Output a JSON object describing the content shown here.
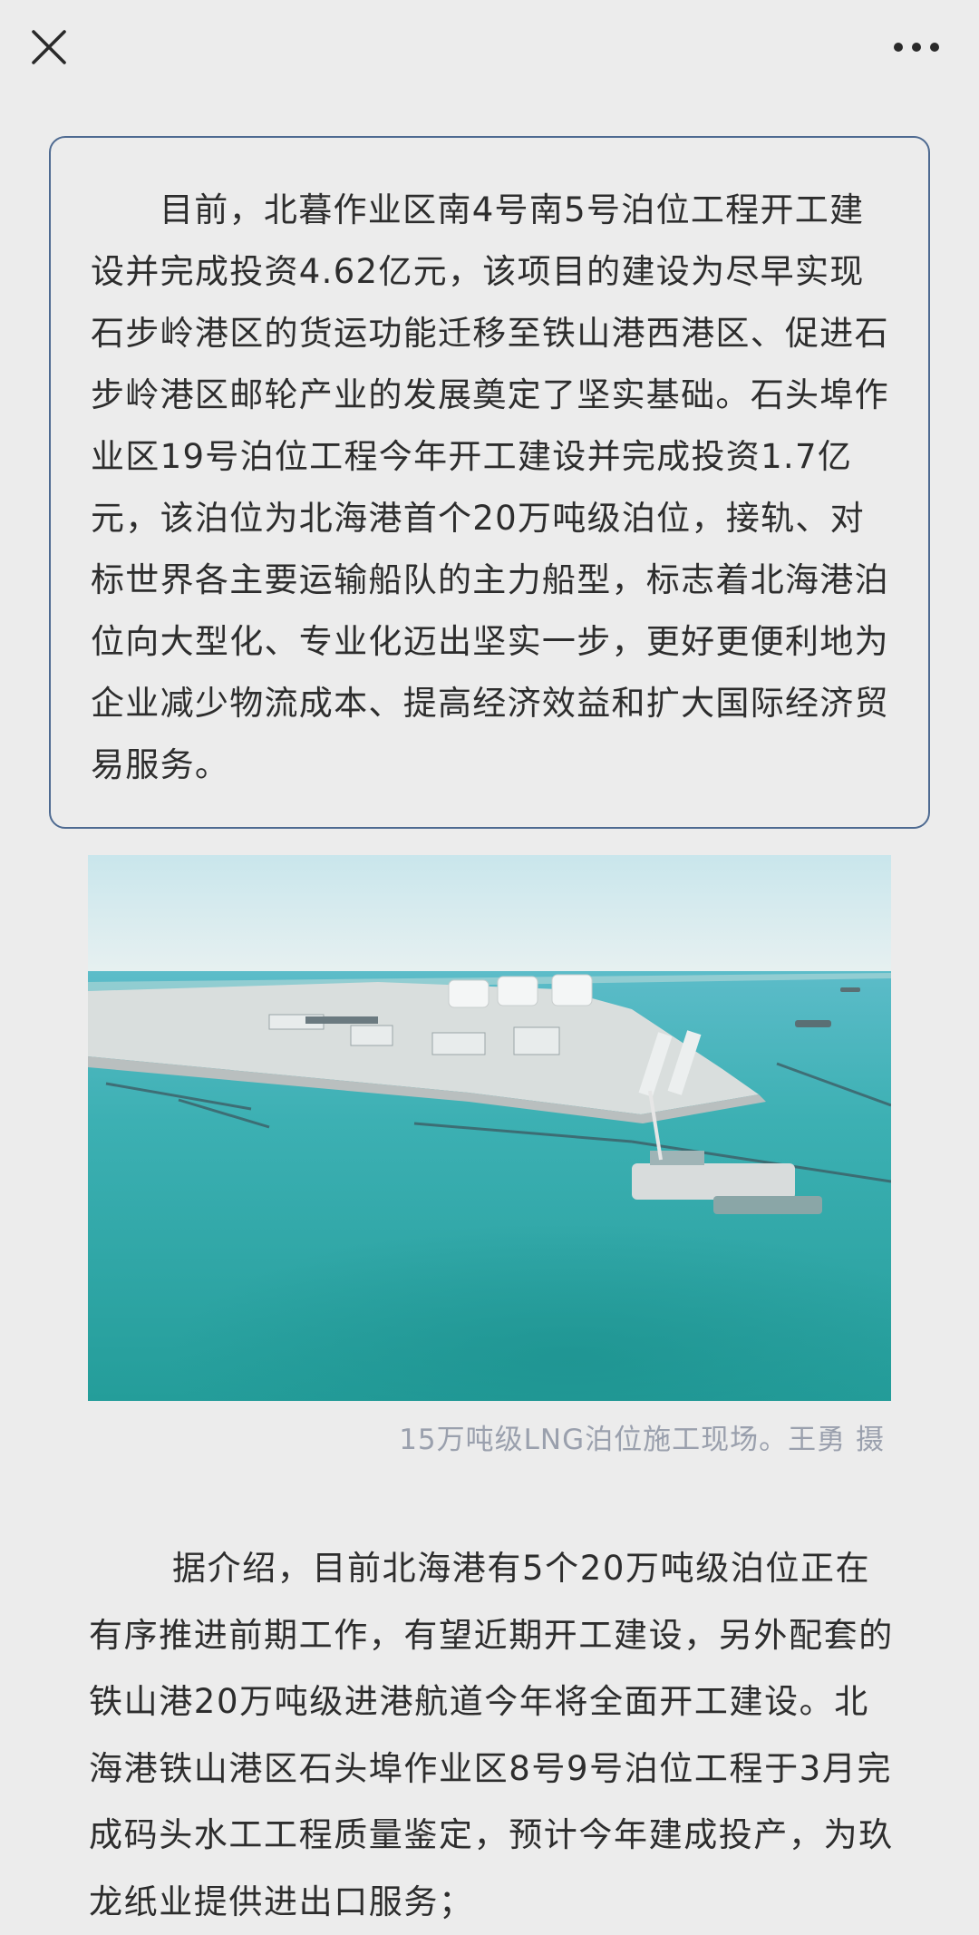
{
  "header": {
    "close_icon": "close-icon",
    "more_icon": "more-horizontal-icon"
  },
  "article": {
    "quote_paragraph": "目前，北暮作业区南4号南5号泊位工程开工建设并完成投资4.62亿元，该项目的建设为尽早实现石步岭港区的货运功能迁移至铁山港西港区、促进石步岭港区邮轮产业的发展奠定了坚实基础。石头埠作业区19号泊位工程今年开工建设并完成投资1.7亿元，该泊位为北海港首个20万吨级泊位，接轨、对标世界各主要运输船队的主力船型，标志着北海港泊位向大型化、专业化迈出坚实一步，更好更便利地为企业减少物流成本、提高经济效益和扩大国际经济贸易服务。",
    "photo_caption": "15万吨级LNG泊位施工现场。王勇 摄",
    "body_paragraph": "据介绍，目前北海港有5个20万吨级泊位正在有序推进前期工作，有望近期开工建设，另外配套的铁山港20万吨级进港航道今年将全面开工建设。北海港铁山港区石头埠作业区8号9号泊位工程于3月完成码头水工工程质量鉴定，预计今年建成投产，为玖龙纸业提供进出口服务；"
  },
  "colors": {
    "page_background": "#ececec",
    "quote_border": "#4e6a91",
    "text": "#2d2d2d",
    "caption": "#9aa0ad",
    "sea": "#2fa7a6"
  }
}
